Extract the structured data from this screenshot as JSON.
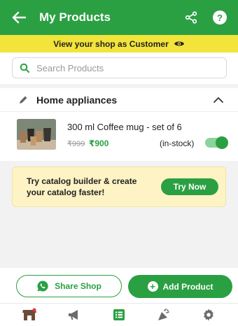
{
  "header": {
    "title": "My Products",
    "back_icon": "arrow-left-icon",
    "share_icon": "share-icon",
    "help_label": "?"
  },
  "banner": {
    "text": "View your shop as Customer",
    "icon": "eye-icon"
  },
  "search": {
    "placeholder": "Search Products",
    "value": ""
  },
  "category": {
    "name": "Home appliances",
    "expanded": true,
    "products": [
      {
        "name": "300 ml Coffee mug - set of 6",
        "original_price": "₹999",
        "price": "₹900",
        "stock_status": "(in-stock)",
        "enabled": true
      }
    ]
  },
  "promo": {
    "line1": "Try catalog builder & create",
    "line2": "your catalog faster!",
    "cta": "Try Now"
  },
  "actions": {
    "share_label": "Share Shop",
    "add_label": "Add Product"
  },
  "bottom_nav": [
    "store-icon",
    "megaphone-icon",
    "list-icon",
    "party-icon",
    "gear-icon"
  ],
  "colors": {
    "primary": "#2aa043",
    "banner": "#f2e43a",
    "promo_bg": "#fdf3c4"
  }
}
